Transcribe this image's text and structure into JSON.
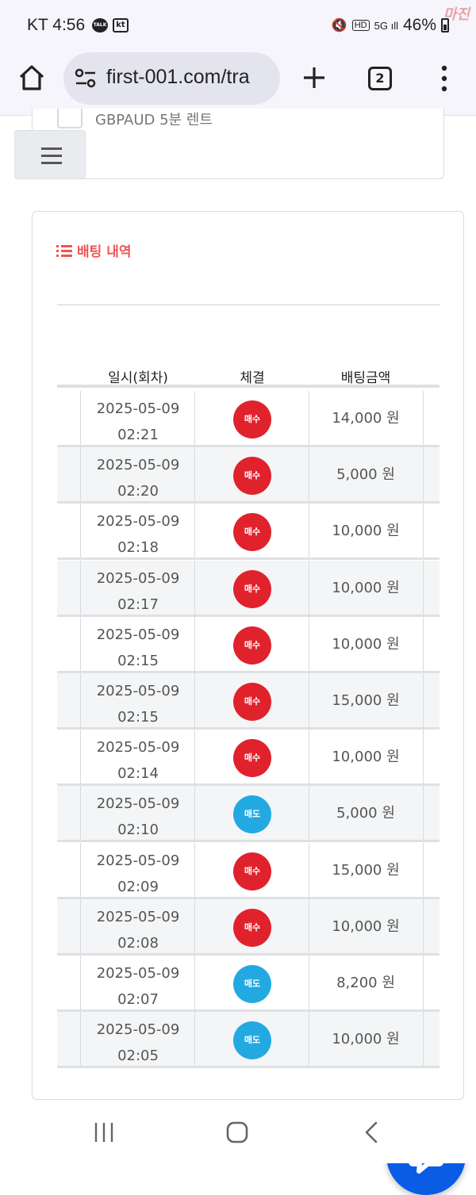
{
  "status_bar": {
    "time": "KT 4:56",
    "talk_icon": "talk-icon",
    "kt_icon": "kt",
    "battery": "46%",
    "watermark": "마진"
  },
  "browser": {
    "url": "first-001.com/tra",
    "tab_count": "2"
  },
  "top_card": {
    "item_label": "GBPAUD 5분 렌트"
  },
  "bet_history": {
    "title": "배팅 내역",
    "columns": [
      "일시(회차)",
      "체결",
      "배팅금액"
    ],
    "rows": [
      {
        "date": "2025-05-09",
        "time": "02:21",
        "type": "매수",
        "kind": "buy",
        "amount": "14,000 원"
      },
      {
        "date": "2025-05-09",
        "time": "02:20",
        "type": "매수",
        "kind": "buy",
        "amount": "5,000 원"
      },
      {
        "date": "2025-05-09",
        "time": "02:18",
        "type": "매수",
        "kind": "buy",
        "amount": "10,000 원"
      },
      {
        "date": "2025-05-09",
        "time": "02:17",
        "type": "매수",
        "kind": "buy",
        "amount": "10,000 원"
      },
      {
        "date": "2025-05-09",
        "time": "02:15",
        "type": "매수",
        "kind": "buy",
        "amount": "10,000 원"
      },
      {
        "date": "2025-05-09",
        "time": "02:15",
        "type": "매수",
        "kind": "buy",
        "amount": "15,000 원"
      },
      {
        "date": "2025-05-09",
        "time": "02:14",
        "type": "매수",
        "kind": "buy",
        "amount": "10,000 원"
      },
      {
        "date": "2025-05-09",
        "time": "02:10",
        "type": "매도",
        "kind": "sell",
        "amount": "5,000 원"
      },
      {
        "date": "2025-05-09",
        "time": "02:09",
        "type": "매수",
        "kind": "buy",
        "amount": "15,000 원"
      },
      {
        "date": "2025-05-09",
        "time": "02:08",
        "type": "매수",
        "kind": "buy",
        "amount": "10,000 원"
      },
      {
        "date": "2025-05-09",
        "time": "02:07",
        "type": "매도",
        "kind": "sell",
        "amount": "8,200 원"
      },
      {
        "date": "2025-05-09",
        "time": "02:05",
        "type": "매도",
        "kind": "sell",
        "amount": "10,000 원"
      }
    ]
  },
  "colors": {
    "accent": "#f05454",
    "buy": "#e0222c",
    "sell": "#23a9e1",
    "chat_fab": "#0a5ce5"
  }
}
